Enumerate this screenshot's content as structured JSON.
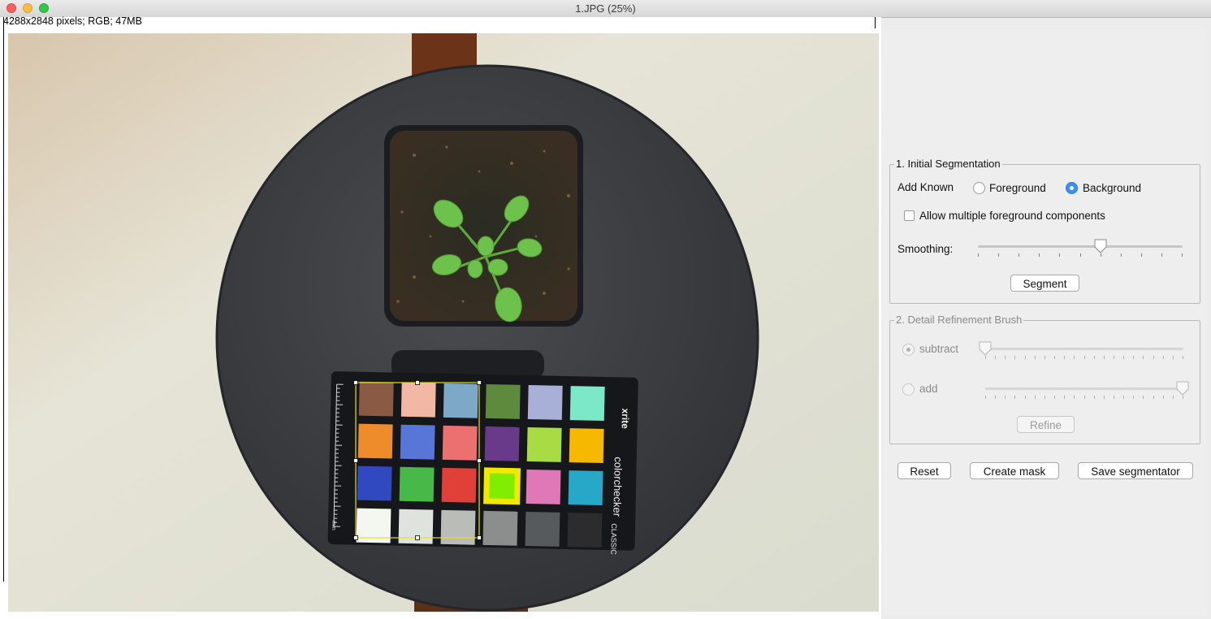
{
  "window": {
    "title": "1.JPG (25%)"
  },
  "image_info": "4288x2848 pixels; RGB; 47MB",
  "colorchecker": {
    "brand": "xrite",
    "product": "colorchecker",
    "edition": "CLASSIC",
    "unit": "mm",
    "patches": [
      "#8b5a44",
      "#f2b8a4",
      "#7ea8c8",
      "#5d8a3c",
      "#a8b0d8",
      "#7ce8c8",
      "#ee8c2c",
      "#5876d8",
      "#ec7070",
      "#6a3a8a",
      "#a8dc44",
      "#f6b800",
      "#3048c0",
      "#48b848",
      "#e04038",
      "#80ee00",
      "#e078b8",
      "#28a8c8",
      "#f4f6f0",
      "#dfe3dd",
      "#babdb7",
      "#8b8e8c",
      "#575a5c",
      "#2c2c2e"
    ]
  },
  "panel": {
    "initial_segmentation": {
      "title": "1. Initial Segmentation",
      "add_known_label": "Add Known",
      "foreground_label": "Foreground",
      "background_label": "Background",
      "selected": "Background",
      "allow_multiple_label": "Allow multiple foreground components",
      "allow_multiple_checked": false,
      "smoothing_label": "Smoothing:",
      "smoothing_value": 0.6,
      "segment_label": "Segment"
    },
    "detail_refinement": {
      "title": "2. Detail Refinement Brush",
      "subtract_label": "subtract",
      "add_label": "add",
      "subtract_slider_value": 0.0,
      "add_slider_value": 1.0,
      "refine_label": "Refine"
    },
    "actions": {
      "reset_label": "Reset",
      "create_mask_label": "Create mask",
      "save_segmentator_label": "Save segmentator"
    }
  }
}
